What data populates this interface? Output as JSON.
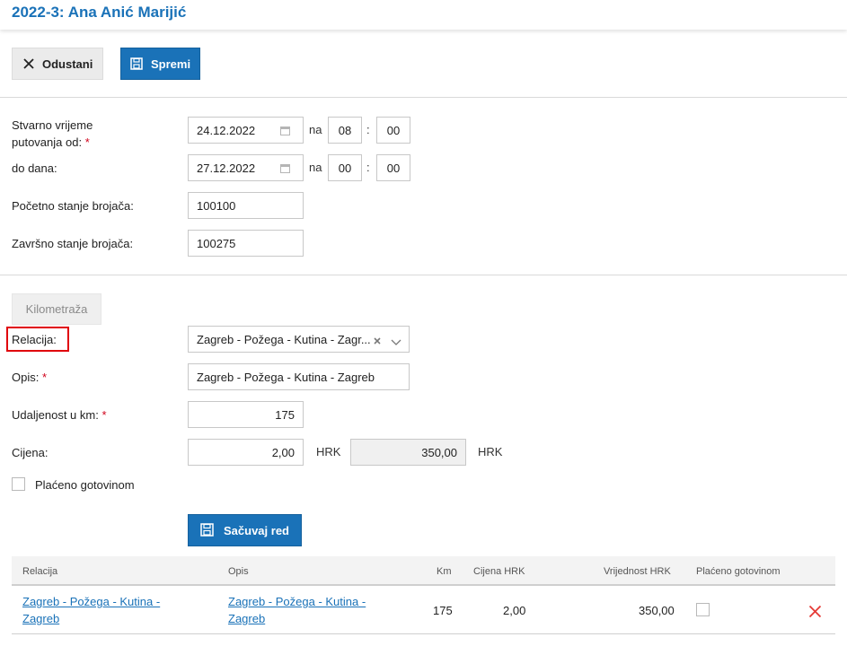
{
  "header": {
    "title": "2022-3: Ana Anić Marijić"
  },
  "toolbar": {
    "cancel_label": "Odustani",
    "save_label": "Spremi"
  },
  "travel": {
    "from_label_line1": "Stvarno vrijeme",
    "from_label_line2": "putovanja od:",
    "required_mark": "*",
    "from_date": "24.12.2022",
    "na_label": "na",
    "colon": ":",
    "from_hour": "08",
    "from_minute": "00",
    "to_label": "do dana:",
    "to_date": "27.12.2022",
    "to_hour": "00",
    "to_minute": "00",
    "start_odometer_label": "Početno stanje brojača:",
    "start_odometer": "100100",
    "end_odometer_label": "Završno stanje brojača:",
    "end_odometer": "100275"
  },
  "mileage": {
    "tab_label": "Kilometraža",
    "relation_label": "Relacija:",
    "relation_value": "Zagreb - Požega - Kutina - Zagr...",
    "description_label": "Opis:",
    "description_value": "Zagreb - Požega - Kutina - Zagreb",
    "distance_label": "Udaljenost u km:",
    "distance_value": "175",
    "price_label": "Cijena:",
    "price_value": "2,00",
    "currency": "HRK",
    "total_value": "350,00",
    "cash_label": "Plaćeno gotovinom",
    "save_row_label": "Sačuvaj red"
  },
  "table": {
    "headers": [
      "Relacija",
      "Opis",
      "Km",
      "Cijena HRK",
      "Vrijednost HRK",
      "Plaćeno gotovinom"
    ],
    "rows": [
      {
        "relation_line1": "Zagreb - Požega - Kutina -",
        "relation_line2": "Zagreb",
        "description_line1": "Zagreb - Požega - Kutina -",
        "description_line2": "Zagreb",
        "km": "175",
        "price": "2,00",
        "value": "350,00",
        "cash": false
      }
    ]
  },
  "colors": {
    "accent": "#1a72b8",
    "required": "#d0021b",
    "highlight": "#e0000b",
    "delete": "#e53935"
  }
}
